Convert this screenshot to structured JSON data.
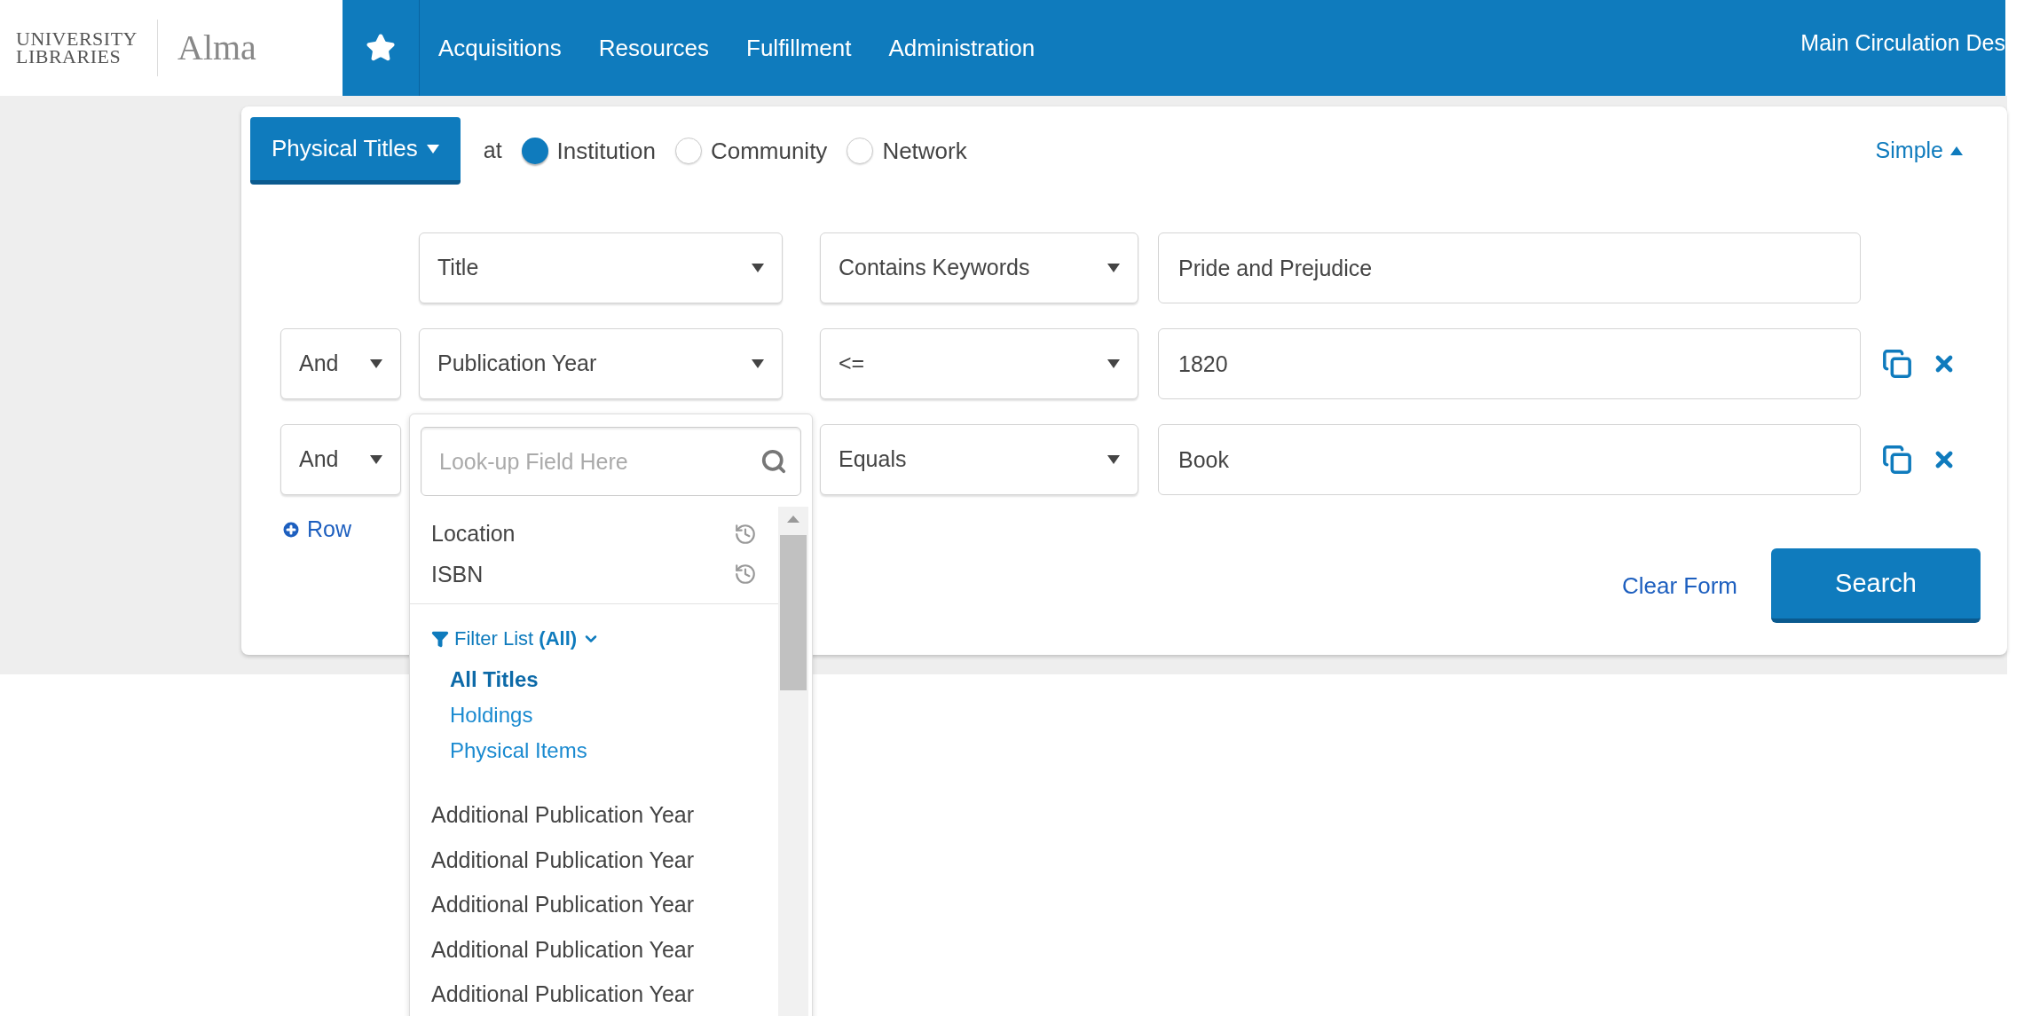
{
  "header": {
    "logo_lines": [
      "UNIVERSITY",
      "LIBRARIES"
    ],
    "app_name": "Alma",
    "nav": [
      "Acquisitions",
      "Resources",
      "Fulfillment",
      "Administration"
    ],
    "location": "Main Circulation Des"
  },
  "search": {
    "scope_button": "Physical Titles",
    "at_label": "at",
    "scopes": [
      {
        "label": "Institution",
        "selected": true
      },
      {
        "label": "Community",
        "selected": false
      },
      {
        "label": "Network",
        "selected": false
      }
    ],
    "mode_toggle": "Simple"
  },
  "rows": [
    {
      "kind": "select",
      "field": "Title",
      "condition": "Contains Keywords",
      "value": "Pride and Prejudice",
      "removable": false
    },
    {
      "kind": "select",
      "boolean": "And",
      "field": "Publication Year",
      "condition": "<=",
      "value": "1820",
      "removable": true
    },
    {
      "kind": "lookup",
      "boolean": "And",
      "placeholder": "Look-up Field Here",
      "condition": "Equals",
      "value": "Book",
      "removable": true
    }
  ],
  "add_row": "Row",
  "clear_form": "Clear Form",
  "submit": "Search",
  "lookup_menu": {
    "recent": [
      "Location",
      "ISBN"
    ],
    "filter_label": "Filter List **(All)**",
    "filters": [
      {
        "label": "All Titles",
        "selected": true
      },
      {
        "label": "Holdings",
        "selected": false
      },
      {
        "label": "Physical Items",
        "selected": false
      }
    ],
    "fields": [
      "Additional Publication Year",
      "Additional Publication Year",
      "Additional Publication Year",
      "Additional Publication Year",
      "Additional Publication Year"
    ]
  }
}
